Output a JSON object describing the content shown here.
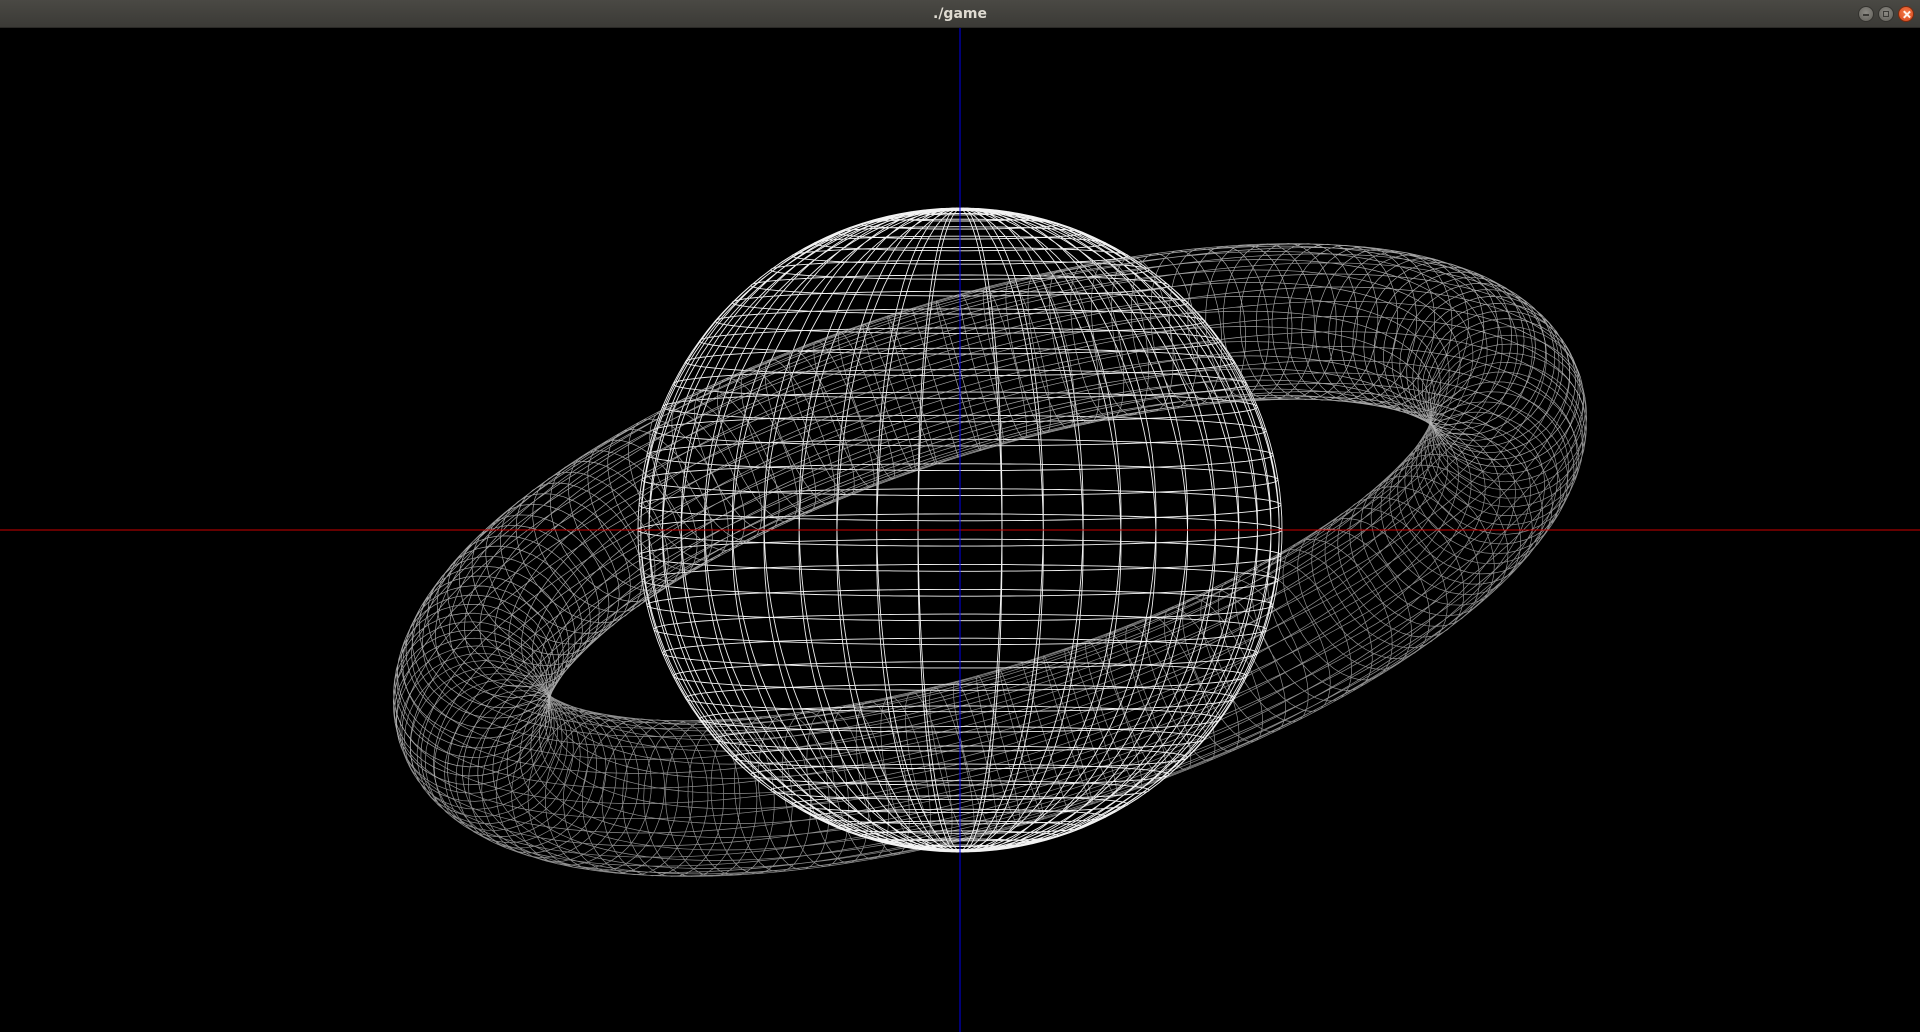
{
  "window": {
    "title": "./game",
    "controls": {
      "minimize_icon": "minimize-icon",
      "maximize_icon": "maximize-icon",
      "close_icon": "close-icon"
    }
  },
  "scene": {
    "background": "#000000",
    "x_axis_color": "#cc0000",
    "y_axis_color": "#0000ee",
    "sphere_wire_color": "#ffffff",
    "torus_wire_color": "#bfbfbf",
    "sphere": {
      "latitude_lines": 40,
      "longitude_lines": 48
    },
    "torus": {
      "major_segments": 140,
      "minor_segments": 32
    }
  }
}
